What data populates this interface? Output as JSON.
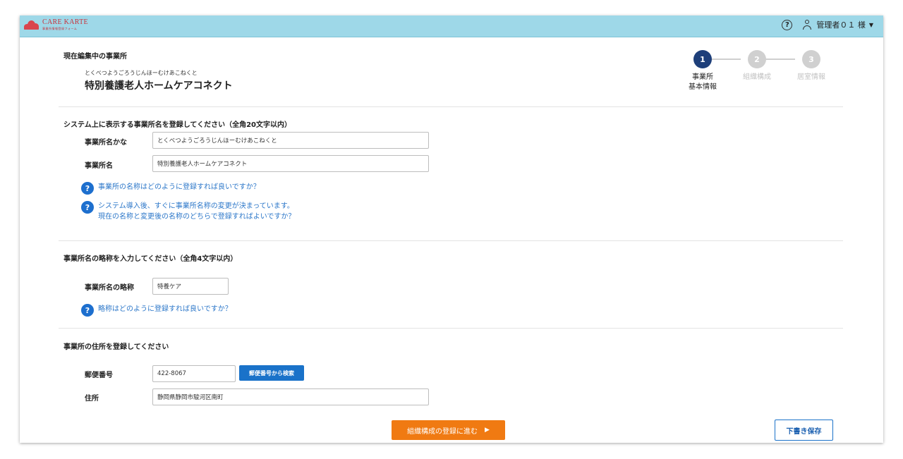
{
  "header": {
    "logo_name": "CARE KARTE",
    "logo_sub": "事業所情報登録フォーム",
    "help_icon_glyph": "?",
    "user_label": "管理者０１ 様"
  },
  "current": {
    "heading": "現在編集中の事業所",
    "kana": "とくべつようごろうじんほーむけあこねくと",
    "name": "特別養護老人ホームケアコネクト"
  },
  "stepper": {
    "steps": [
      {
        "number": "1",
        "label_line1": "事業所",
        "label_line2": "基本情報",
        "active": true
      },
      {
        "number": "2",
        "label_line1": "組織構成",
        "label_line2": "",
        "active": false
      },
      {
        "number": "3",
        "label_line1": "居室情報",
        "label_line2": "",
        "active": false
      }
    ]
  },
  "section_name": {
    "title": "システム上に表示する事業所名を登録してください（全角20文字以内）",
    "kana_label": "事業所名かな",
    "kana_value": "とくべつようごろうじんほーむけあこねくと",
    "name_label": "事業所名",
    "name_value": "特別養護老人ホームケアコネクト",
    "faq1": "事業所の名称はどのように登録すれば良いですか？",
    "faq2_line1": "システム導入後、すぐに事業所名称の変更が決まっています。",
    "faq2_line2": "現在の名称と変更後の名称のどちらで登録すればよいですか？"
  },
  "section_abbr": {
    "title": "事業所名の略称を入力してください（全角4文字以内）",
    "abbr_label": "事業所名の略称",
    "abbr_value": "特養ケア",
    "faq": "略称はどのように登録すれば良いですか？"
  },
  "section_address": {
    "title": "事業所の住所を登録してください",
    "postal_label": "郵便番号",
    "postal_value": "422-8067",
    "search_button": "郵便番号から検索",
    "address_label": "住所",
    "address_value": "静岡県静岡市駿河区南町"
  },
  "footer": {
    "next_button": "組織構成の登録に進む",
    "next_arrow": "▶",
    "draft_button": "下書き保存"
  },
  "colors": {
    "topbar": "#9ed8e8",
    "step_active": "#1e3f7a",
    "step_inactive": "#d0d0d0",
    "link_blue": "#2c77c9",
    "primary_blue": "#1a72c9",
    "orange": "#f07a12"
  }
}
